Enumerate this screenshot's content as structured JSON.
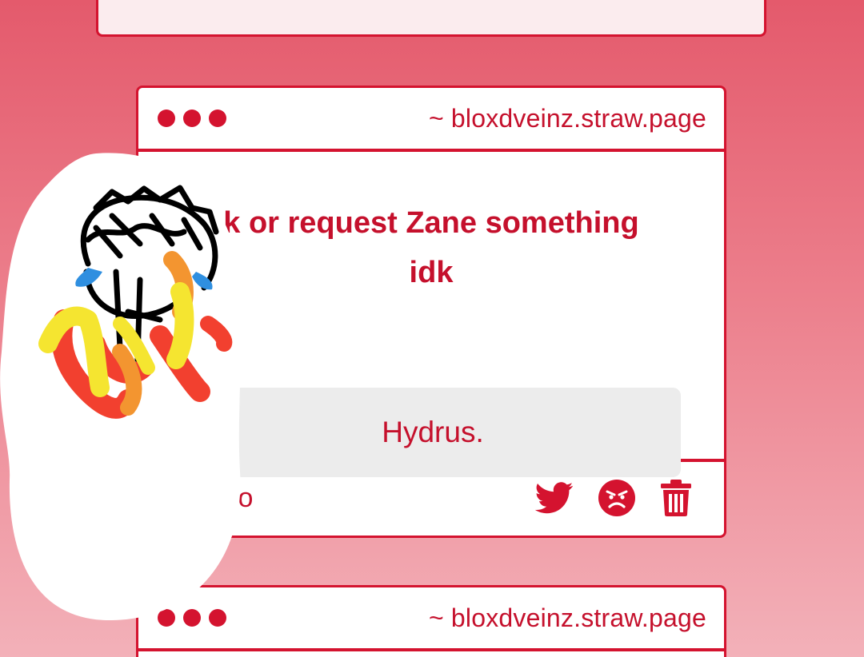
{
  "main_card": {
    "site": "~ bloxdveinz.straw.page",
    "question_line1": "k or request Zane something",
    "question_line2": "idk",
    "answer": "Hydrus.",
    "timestamp": "urs ago",
    "actions": [
      "twitter-icon",
      "angry-face-icon",
      "trash-icon"
    ]
  },
  "next_card": {
    "site": "~ bloxdveinz.straw.page"
  },
  "colors": {
    "accent": "#d4132f",
    "text_red": "#c5102c",
    "answer_bg": "#ececec",
    "bg_top": "#e45a6c",
    "bg_bottom": "#f3b1b9"
  }
}
